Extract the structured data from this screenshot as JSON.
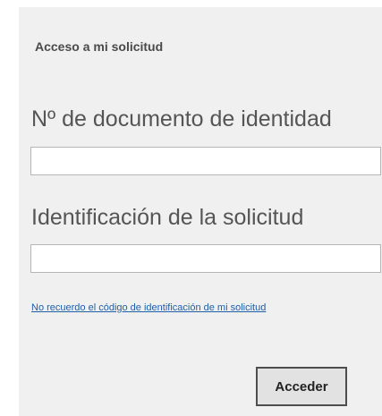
{
  "form": {
    "title": "Acceso a mi solicitud",
    "document_field": {
      "label": "Nº de documento de identidad",
      "value": "",
      "placeholder": ""
    },
    "request_field": {
      "label": "Identificación de la solicitud",
      "value": "",
      "placeholder": ""
    },
    "forgot_link": "No recuerdo el código de identificación de mi solicitud",
    "submit_label": "Acceder"
  },
  "colors": {
    "panel_background": "#f0f0f0",
    "link": "#1f5fa8",
    "label_text": "#555555",
    "button_background": "#e2e2e2",
    "button_border": "#4d4d4d"
  }
}
